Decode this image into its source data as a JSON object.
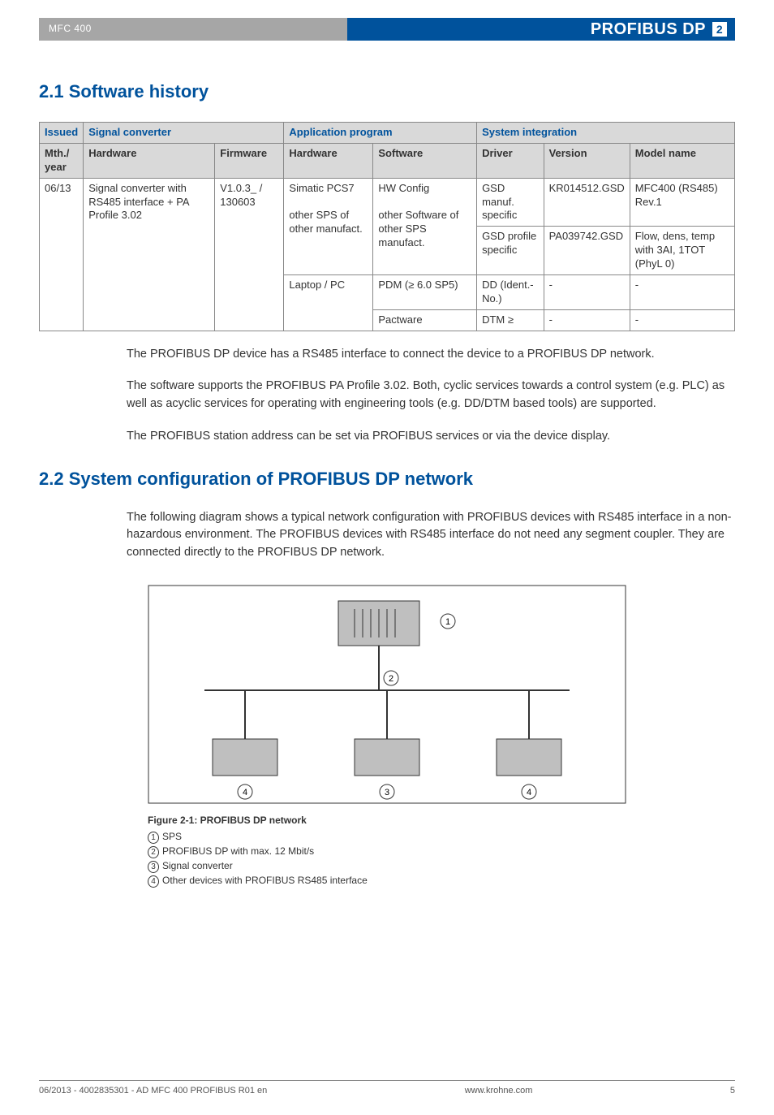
{
  "header": {
    "device": "MFC 400",
    "title": "PROFIBUS DP",
    "badge": "2"
  },
  "sections": {
    "s21": "2.1  Software history",
    "s22": "2.2  System configuration of PROFIBUS DP network"
  },
  "table": {
    "head": {
      "issued": "Issued",
      "signal_converter": "Signal converter",
      "application_program": "Application program",
      "system_integration": "System integration",
      "mth_year": "Mth./\nyear",
      "hardware": "Hardware",
      "firmware": "Firmware",
      "app_hardware": "Hardware",
      "software": "Software",
      "driver": "Driver",
      "version": "Version",
      "model_name": "Model name"
    },
    "r1": {
      "issued": "06/13",
      "hw": "Signal converter with RS485 interface + PA Profile 3.02",
      "fw": "V1.0.3_ / 130603",
      "app_hw_a": "Simatic PCS7",
      "app_hw_b": "other SPS of other manufact.",
      "sw_a": "HW Config",
      "sw_b": "other Software of other SPS manufact.",
      "drv_a": "GSD manuf. specific",
      "drv_b": "GSD profile specific",
      "ver_a": "KR014512.GSD",
      "ver_b": "PA039742.GSD",
      "mdl_a": "MFC400 (RS485) Rev.1",
      "mdl_b": "Flow, dens, temp with 3AI, 1TOT (PhyL 0)"
    },
    "r2": {
      "app_hw": "Laptop / PC",
      "sw_a": "PDM (≥ 6.0 SP5)",
      "drv_a": "DD (Ident.-No.)",
      "ver_a": "-",
      "mdl_a": "-",
      "sw_b": "Pactware",
      "drv_b": "DTM ≥",
      "ver_b": "-",
      "mdl_b": "-"
    }
  },
  "paras": {
    "p1": "The PROFIBUS DP device has a RS485 interface to connect the device to a PROFIBUS DP network.",
    "p2": "The software supports the PROFIBUS PA Profile 3.02. Both, cyclic services towards a control system (e.g. PLC) as well as acyclic services for operating with engineering tools (e.g. DD/DTM based tools) are supported.",
    "p3": "The PROFIBUS station address can be set via PROFIBUS services or via the device display.",
    "p4": "The following diagram shows a typical network configuration with PROFIBUS devices with RS485 interface in a non-hazardous environment. The PROFIBUS devices with RS485 interface do not need any segment coupler. They are connected directly to the PROFIBUS DP network."
  },
  "figure": {
    "caption": "Figure 2-1: PROFIBUS DP network",
    "l1": "SPS",
    "l2": "PROFIBUS DP with max. 12 Mbit/s",
    "l3": "Signal converter",
    "l4": "Other devices with PROFIBUS RS485 interface"
  },
  "footer": {
    "left": "06/2013 - 4002835301 - AD MFC 400 PROFIBUS R01 en",
    "center": "www.krohne.com",
    "right": "5"
  }
}
